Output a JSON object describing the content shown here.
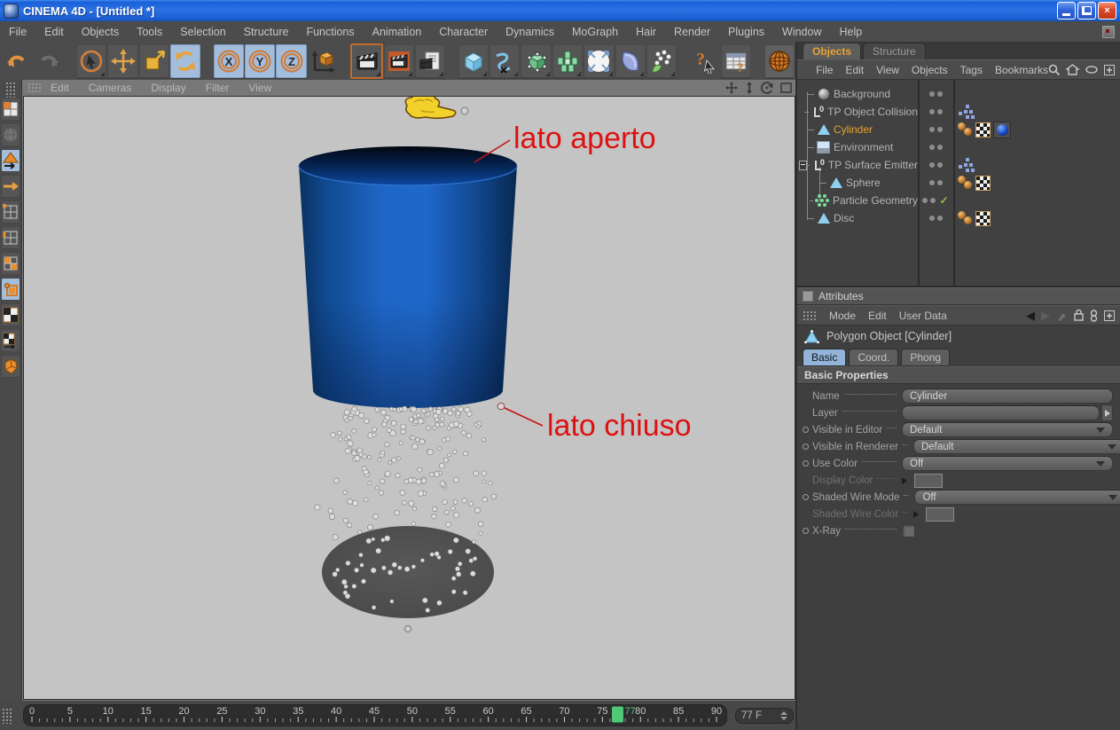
{
  "window": {
    "title": "CINEMA 4D - [Untitled *]"
  },
  "menu_bar": {
    "items": [
      "File",
      "Edit",
      "Objects",
      "Tools",
      "Selection",
      "Structure",
      "Functions",
      "Animation",
      "Character",
      "Dynamics",
      "MoGraph",
      "Hair",
      "Render",
      "Plugins",
      "Window",
      "Help"
    ]
  },
  "toolbar": {
    "buttons": [
      "undo",
      "redo",
      "live-selection",
      "move",
      "scale",
      "rotate",
      "lock-x-axis",
      "lock-y-axis",
      "lock-z-axis",
      "coordinate-system",
      "render-view",
      "render-active-view",
      "render-settings",
      "add-primitive",
      "add-spline",
      "add-modeling-object",
      "add-array",
      "add-particle-emitter",
      "add-environment",
      "add-effector",
      "help",
      "command-manager",
      "online-updater"
    ]
  },
  "left_toolbar": {
    "buttons": [
      "make-editable",
      "model-mode",
      "object-axis-mode",
      "axis-mode",
      "point-mode",
      "edge-mode",
      "polygon-mode",
      "object-mode",
      "texture-mode",
      "texture-axis-mode",
      "animation-mode"
    ]
  },
  "viewport": {
    "menu": [
      "Edit",
      "Cameras",
      "Display",
      "Filter",
      "View"
    ],
    "nav": [
      "pan",
      "dolly",
      "rotate",
      "maximize"
    ],
    "scene": {
      "cylinder_color": "#1b5cb4",
      "disc_color": "#4e4e4e",
      "particle_color": "#dcdcdc",
      "annotation_color": "#dd1111",
      "annotations": [
        {
          "text": "lato aperto"
        },
        {
          "text": "lato chiuso"
        }
      ]
    }
  },
  "object_manager": {
    "tabs": [
      {
        "label": "Objects",
        "active": true
      },
      {
        "label": "Structure",
        "active": false
      }
    ],
    "menu": [
      "File",
      "Edit",
      "View",
      "Objects",
      "Tags",
      "Bookmarks"
    ],
    "menu_icons": [
      "search-icon",
      "home-icon",
      "eye-icon",
      "add-panel-icon"
    ],
    "tree": [
      {
        "label": "Background",
        "icon": "background-object"
      },
      {
        "label": "TP Object Collision",
        "icon": "tp-node",
        "tags": [
          "expression-tag"
        ]
      },
      {
        "label": "Cylinder",
        "icon": "polygon-object",
        "selected": true,
        "tags": [
          "phong-tag",
          "uvw-tag",
          "material-tag"
        ]
      },
      {
        "label": "Environment",
        "icon": "environment-object"
      },
      {
        "label": "TP Surface Emitter",
        "icon": "tp-node",
        "expanded": true,
        "tags": [
          "expression-tag"
        ]
      },
      {
        "label": "Sphere",
        "icon": "polygon-object",
        "child": true,
        "tags": [
          "phong-tag",
          "uvw-tag"
        ]
      },
      {
        "label": "Particle Geometry",
        "icon": "particle-geometry",
        "child": true,
        "enabled_check": true
      },
      {
        "label": "Disc",
        "icon": "polygon-object",
        "tags": [
          "phong-tag",
          "uvw-tag"
        ]
      }
    ]
  },
  "attributes": {
    "title": "Attributes",
    "menu": [
      "Mode",
      "Edit",
      "User Data"
    ],
    "object_header": "Polygon Object [Cylinder]",
    "tabs": [
      {
        "label": "Basic",
        "active": true
      },
      {
        "label": "Coord.",
        "active": false
      },
      {
        "label": "Phong",
        "active": false
      }
    ],
    "section": "Basic Properties",
    "properties": [
      {
        "label": "Name",
        "type": "text",
        "value": "Cylinder"
      },
      {
        "label": "Layer",
        "type": "layer",
        "value": ""
      },
      {
        "label": "Visible in Editor",
        "type": "dropdown",
        "value": "Default",
        "animatable": true
      },
      {
        "label": "Visible in Renderer",
        "type": "dropdown",
        "value": "Default",
        "animatable": true
      },
      {
        "label": "Use Color",
        "type": "dropdown",
        "value": "Off",
        "animatable": true
      },
      {
        "label": "Display Color",
        "type": "color",
        "disabled": true
      },
      {
        "label": "Shaded Wire Mode",
        "type": "dropdown",
        "value": "Off",
        "animatable": true
      },
      {
        "label": "Shaded Wire Color",
        "type": "color",
        "disabled": true
      },
      {
        "label": "X-Ray",
        "type": "checkbox",
        "animatable": true
      }
    ]
  },
  "timeline": {
    "start": 0,
    "end": 90,
    "label_step": 5,
    "current_frame": 77,
    "marker_color": "#4fc878",
    "frame_field_value": "77 F"
  }
}
